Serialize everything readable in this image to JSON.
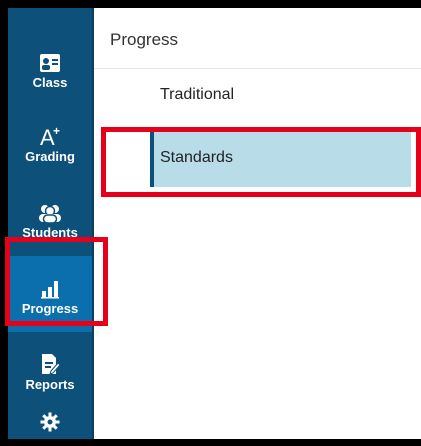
{
  "sidebar": {
    "items": [
      {
        "label": "Class",
        "icon": "class-icon"
      },
      {
        "label": "Grading",
        "icon": "grading-icon"
      },
      {
        "label": "Students",
        "icon": "students-icon"
      },
      {
        "label": "Progress",
        "icon": "progress-icon",
        "active": true
      },
      {
        "label": "Reports",
        "icon": "reports-icon"
      },
      {
        "label": "",
        "icon": "settings-icon"
      }
    ]
  },
  "panel": {
    "title": "Progress",
    "options": [
      {
        "label": "Traditional"
      },
      {
        "label": "Standards",
        "selected": true
      }
    ]
  },
  "colors": {
    "sidebar": "#0d5079",
    "active": "#0b6fae",
    "selected_bg": "#b9dce9",
    "highlight": "#e6001a"
  }
}
